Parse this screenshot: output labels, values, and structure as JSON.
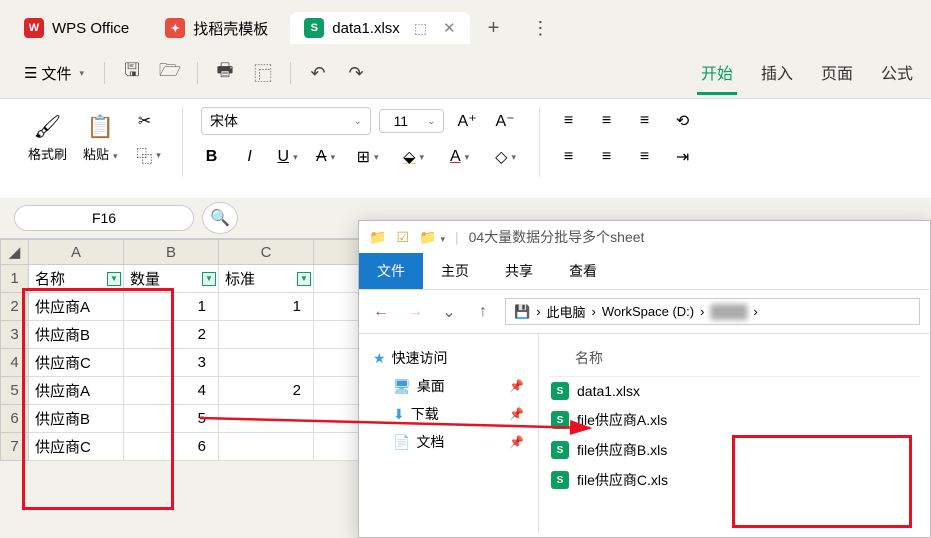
{
  "tabs": {
    "app": "WPS Office",
    "docer": "找稻壳模板",
    "file": "data1.xlsx"
  },
  "toolbar": {
    "file": "文件"
  },
  "menu": {
    "start": "开始",
    "insert": "插入",
    "page": "页面",
    "formula": "公式"
  },
  "ribbon": {
    "formatBrush": "格式刷",
    "paste": "粘贴",
    "fontName": "宋体",
    "fontSize": "11"
  },
  "cellRef": "F16",
  "sheet": {
    "cols": [
      "A",
      "B",
      "C"
    ],
    "headers": [
      "名称",
      "数量",
      "标准"
    ],
    "rows": [
      [
        "供应商A",
        "1",
        "1"
      ],
      [
        "供应商B",
        "2",
        ""
      ],
      [
        "供应商C",
        "3",
        ""
      ],
      [
        "供应商A",
        "4",
        "2"
      ],
      [
        "供应商B",
        "5",
        ""
      ],
      [
        "供应商C",
        "6",
        ""
      ]
    ]
  },
  "explorer": {
    "title": "04大量数据分批导多个sheet",
    "tabs": {
      "file": "文件",
      "home": "主页",
      "share": "共享",
      "view": "查看"
    },
    "breadcrumb": [
      "此电脑",
      "WorkSpace (D:)"
    ],
    "nav": {
      "quick": "快速访问",
      "desktop": "桌面",
      "downloads": "下载",
      "documents": "文档"
    },
    "colName": "名称",
    "files": [
      "data1.xlsx",
      "file供应商A.xls",
      "file供应商B.xls",
      "file供应商C.xls"
    ]
  }
}
